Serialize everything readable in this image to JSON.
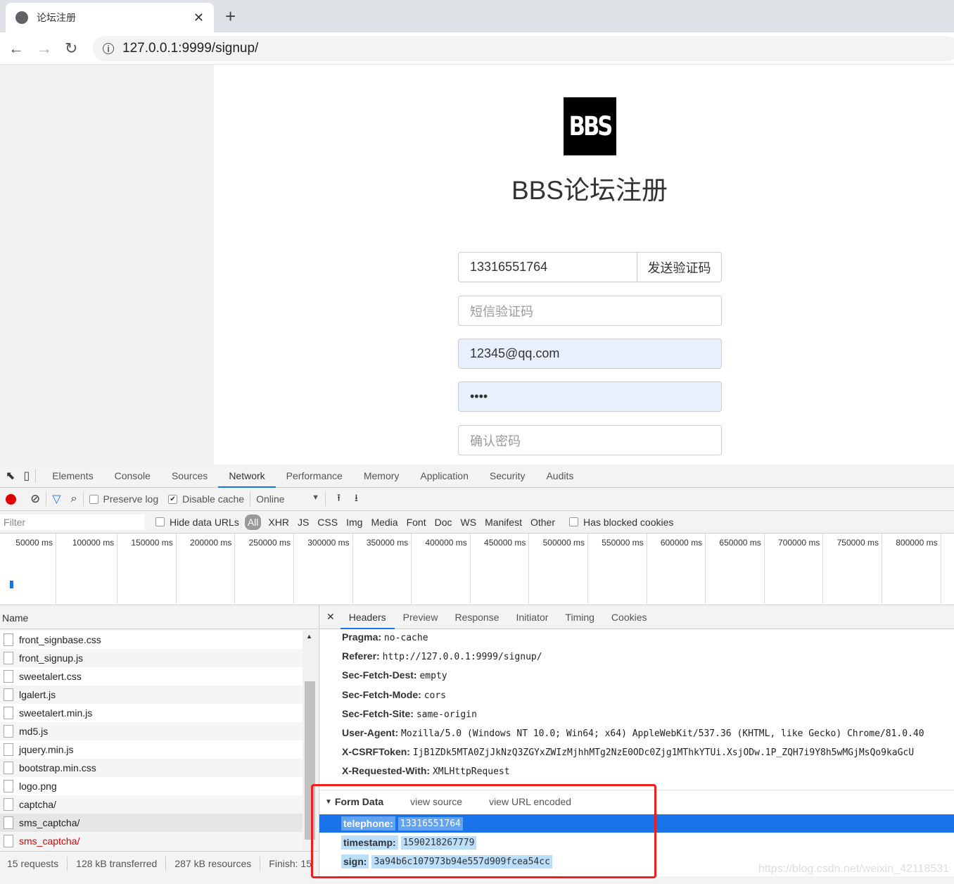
{
  "browser": {
    "tab_title": "论坛注册",
    "url": "127.0.0.1:9999/signup/"
  },
  "page": {
    "logo_text": "BBS",
    "title": "BBS论坛注册",
    "telephone_value": "13316551764",
    "send_code_label": "发送验证码",
    "sms_code_placeholder": "短信验证码",
    "email_value": "12345@qq.com",
    "password_value": "••••",
    "confirm_password_placeholder": "确认密码"
  },
  "devtools": {
    "tabs": [
      "Elements",
      "Console",
      "Sources",
      "Network",
      "Performance",
      "Memory",
      "Application",
      "Security",
      "Audits"
    ],
    "active_tab": "Network",
    "toolbar": {
      "preserve_log": "Preserve log",
      "preserve_log_checked": false,
      "disable_cache": "Disable cache",
      "disable_cache_checked": true,
      "throttle": "Online"
    },
    "filter": {
      "placeholder": "Filter",
      "hide_data_urls": "Hide data URLs",
      "types": [
        "All",
        "XHR",
        "JS",
        "CSS",
        "Img",
        "Media",
        "Font",
        "Doc",
        "WS",
        "Manifest",
        "Other"
      ],
      "active_type": "All",
      "has_blocked_cookies": "Has blocked cookies"
    },
    "timeline_ticks": [
      "50000 ms",
      "100000 ms",
      "150000 ms",
      "200000 ms",
      "250000 ms",
      "300000 ms",
      "350000 ms",
      "400000 ms",
      "450000 ms",
      "500000 ms",
      "550000 ms",
      "600000 ms",
      "650000 ms",
      "700000 ms",
      "750000 ms",
      "800000 ms"
    ],
    "name_header": "Name",
    "requests": [
      {
        "name": "front_signbase.css",
        "error": false
      },
      {
        "name": "front_signup.js",
        "error": false
      },
      {
        "name": "sweetalert.css",
        "error": false
      },
      {
        "name": "lgalert.js",
        "error": false
      },
      {
        "name": "sweetalert.min.js",
        "error": false
      },
      {
        "name": "md5.js",
        "error": false
      },
      {
        "name": "jquery.min.js",
        "error": false
      },
      {
        "name": "bootstrap.min.css",
        "error": false
      },
      {
        "name": "logo.png",
        "error": false
      },
      {
        "name": "captcha/",
        "error": false
      },
      {
        "name": "sms_captcha/",
        "error": false
      },
      {
        "name": "sms_captcha/",
        "error": true
      }
    ],
    "status": {
      "requests": "15 requests",
      "transferred": "128 kB transferred",
      "resources": "287 kB resources",
      "finish": "Finish: 15"
    },
    "detail_tabs": [
      "Headers",
      "Preview",
      "Response",
      "Initiator",
      "Timing",
      "Cookies"
    ],
    "active_detail_tab": "Headers",
    "headers": [
      {
        "k": "Pragma:",
        "v": "no-cache"
      },
      {
        "k": "Referer:",
        "v": "http://127.0.0.1:9999/signup/"
      },
      {
        "k": "Sec-Fetch-Dest:",
        "v": "empty"
      },
      {
        "k": "Sec-Fetch-Mode:",
        "v": "cors"
      },
      {
        "k": "Sec-Fetch-Site:",
        "v": "same-origin"
      },
      {
        "k": "User-Agent:",
        "v": "Mozilla/5.0 (Windows NT 10.0; Win64; x64) AppleWebKit/537.36 (KHTML, like Gecko) Chrome/81.0.40"
      },
      {
        "k": "X-CSRFToken:",
        "v": "IjB1ZDk5MTA0ZjJkNzQ3ZGYxZWIzMjhhMTg2NzE0ODc0Zjg1MThkYTUi.XsjODw.1P_ZQH7i9Y8h5wMGjMsQo9kaGcU"
      },
      {
        "k": "X-Requested-With:",
        "v": "XMLHttpRequest"
      }
    ],
    "form_data": {
      "title": "Form Data",
      "view_source": "view source",
      "view_url_encoded": "view URL encoded",
      "rows": [
        {
          "k": "telephone:",
          "v": "13316551764"
        },
        {
          "k": "timestamp:",
          "v": "1590218267779"
        },
        {
          "k": "sign:",
          "v": "3a94b6c107973b94e557d909fcea54cc"
        }
      ]
    }
  },
  "watermark": "https://blog.csdn.net/weixin_42118531",
  "colors": {
    "accent": "#1a73e8",
    "highlight": "#bbdefb",
    "annotation": "#f01e1e",
    "record": "#e00000",
    "error": "#e00000"
  }
}
